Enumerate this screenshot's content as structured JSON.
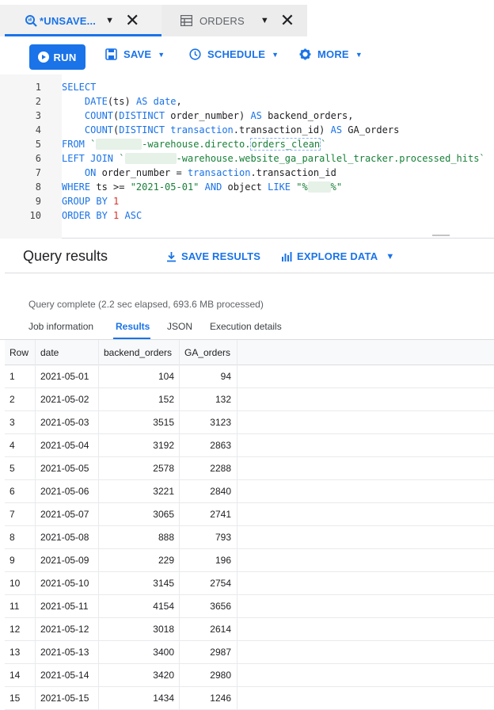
{
  "tabs": [
    {
      "label": "*UNSAVE...",
      "icon": "query-icon",
      "active": true
    },
    {
      "label": "ORDERS",
      "icon": "table-icon",
      "active": false
    }
  ],
  "toolbar": {
    "run_label": "RUN",
    "save_label": "SAVE",
    "schedule_label": "SCHEDULE",
    "more_label": "MORE"
  },
  "editor": {
    "line_numbers": [
      "1",
      "2",
      "3",
      "4",
      "5",
      "6",
      "7",
      "8",
      "9",
      "10"
    ],
    "lines": [
      [
        {
          "t": "SELECT",
          "c": "kw"
        }
      ],
      [
        {
          "t": "    "
        },
        {
          "t": "DATE",
          "c": "kw"
        },
        {
          "t": "(ts) "
        },
        {
          "t": "AS",
          "c": "kw"
        },
        {
          "t": " "
        },
        {
          "t": "date",
          "c": "kw"
        },
        {
          "t": ","
        }
      ],
      [
        {
          "t": "    "
        },
        {
          "t": "COUNT",
          "c": "kw"
        },
        {
          "t": "("
        },
        {
          "t": "DISTINCT",
          "c": "kw"
        },
        {
          "t": " order_number) "
        },
        {
          "t": "AS",
          "c": "kw"
        },
        {
          "t": " backend_orders,"
        }
      ],
      [
        {
          "t": "    "
        },
        {
          "t": "COUNT",
          "c": "kw"
        },
        {
          "t": "("
        },
        {
          "t": "DISTINCT",
          "c": "kw"
        },
        {
          "t": " "
        },
        {
          "t": "transaction",
          "c": "kw"
        },
        {
          "t": ".transaction_id) "
        },
        {
          "t": "AS",
          "c": "kw"
        },
        {
          "t": " GA_orders"
        }
      ],
      [
        {
          "t": "FROM",
          "c": "kw"
        },
        {
          "t": " "
        },
        {
          "t": "`",
          "c": "str"
        },
        {
          "t": "xxxxxxxx",
          "c": "blur"
        },
        {
          "t": "-warehouse.directo.",
          "c": "str"
        },
        {
          "t": "orders_clean",
          "c": "str hl"
        },
        {
          "t": "`",
          "c": "str"
        }
      ],
      [
        {
          "t": "LEFT JOIN",
          "c": "kw"
        },
        {
          "t": " "
        },
        {
          "t": "`",
          "c": "str"
        },
        {
          "t": "xxxxxxxxx",
          "c": "blur"
        },
        {
          "t": "-warehouse.website_ga_parallel_tracker.processed_hits`",
          "c": "str"
        }
      ],
      [
        {
          "t": "    "
        },
        {
          "t": "ON",
          "c": "kw"
        },
        {
          "t": " order_number = "
        },
        {
          "t": "transaction",
          "c": "kw"
        },
        {
          "t": ".transaction_id"
        }
      ],
      [
        {
          "t": "WHERE",
          "c": "kw"
        },
        {
          "t": " ts >= "
        },
        {
          "t": "\"2021-05-01\"",
          "c": "str"
        },
        {
          "t": " "
        },
        {
          "t": "AND",
          "c": "kw"
        },
        {
          "t": " object "
        },
        {
          "t": "LIKE",
          "c": "kw"
        },
        {
          "t": " "
        },
        {
          "t": "\"%",
          "c": "str"
        },
        {
          "t": "xxxx",
          "c": "blur"
        },
        {
          "t": "%\"",
          "c": "str"
        }
      ],
      [
        {
          "t": "GROUP BY",
          "c": "kw"
        },
        {
          "t": " "
        },
        {
          "t": "1",
          "c": "num"
        }
      ],
      [
        {
          "t": "ORDER BY",
          "c": "kw"
        },
        {
          "t": " "
        },
        {
          "t": "1",
          "c": "num"
        },
        {
          "t": " "
        },
        {
          "t": "ASC",
          "c": "kw"
        }
      ]
    ]
  },
  "results": {
    "title": "Query results",
    "save_results_label": "SAVE RESULTS",
    "explore_data_label": "EXPLORE DATA",
    "status": "Query complete (2.2 sec elapsed, 693.6 MB processed)",
    "tabs": [
      "Job information",
      "Results",
      "JSON",
      "Execution details"
    ],
    "active_tab": "Results",
    "columns": [
      "Row",
      "date",
      "backend_orders",
      "GA_orders"
    ],
    "rows": [
      [
        "1",
        "2021-05-01",
        "104",
        "94"
      ],
      [
        "2",
        "2021-05-02",
        "152",
        "132"
      ],
      [
        "3",
        "2021-05-03",
        "3515",
        "3123"
      ],
      [
        "4",
        "2021-05-04",
        "3192",
        "2863"
      ],
      [
        "5",
        "2021-05-05",
        "2578",
        "2288"
      ],
      [
        "6",
        "2021-05-06",
        "3221",
        "2840"
      ],
      [
        "7",
        "2021-05-07",
        "3065",
        "2741"
      ],
      [
        "8",
        "2021-05-08",
        "888",
        "793"
      ],
      [
        "9",
        "2021-05-09",
        "229",
        "196"
      ],
      [
        "10",
        "2021-05-10",
        "3145",
        "2754"
      ],
      [
        "11",
        "2021-05-11",
        "4154",
        "3656"
      ],
      [
        "12",
        "2021-05-12",
        "3018",
        "2614"
      ],
      [
        "13",
        "2021-05-13",
        "3400",
        "2987"
      ],
      [
        "14",
        "2021-05-14",
        "3420",
        "2980"
      ],
      [
        "15",
        "2021-05-15",
        "1434",
        "1246"
      ]
    ]
  },
  "colors": {
    "accent": "#1a73e8",
    "keyword": "#1a73e8",
    "string": "#188038",
    "number": "#d93025"
  }
}
